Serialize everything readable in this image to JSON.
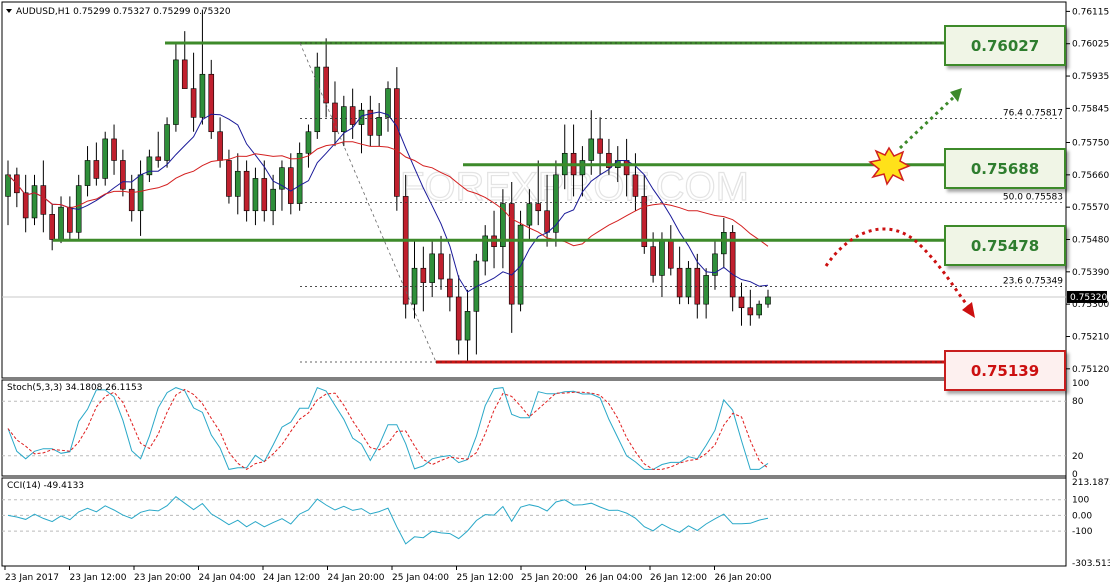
{
  "header": {
    "symbol": "AUDUSD,H1",
    "ohlc": "0.75299 0.75327 0.75299 0.75320",
    "title": "AUDUSD,H1  0.75299 0.75327 0.75299 0.75320"
  },
  "watermark": "FOREXPROF.COM",
  "price_axis": {
    "ticks": [
      "0.76115",
      "0.76025",
      "0.75935",
      "0.75845",
      "0.75750",
      "0.75660",
      "0.75570",
      "0.75480",
      "0.75390",
      "0.75300",
      "0.75210",
      "0.75120"
    ],
    "current_price": "0.75320"
  },
  "levels": [
    {
      "value": "0.76027",
      "color": "#3d8a2a",
      "style": "resistance"
    },
    {
      "value": "0.75688",
      "color": "#3d8a2a",
      "style": "resistance"
    },
    {
      "value": "0.75478",
      "color": "#3d8a2a",
      "style": "support"
    },
    {
      "value": "0.75139",
      "color": "#c81e1e",
      "style": "support"
    }
  ],
  "fibonacci": [
    {
      "label": "76.4  0.75817"
    },
    {
      "label": "50.0  0.75583"
    },
    {
      "label": "23.6  0.75349"
    }
  ],
  "stoch": {
    "title": "Stoch(5,3,3) 34.1808 26.1153",
    "ticks": [
      "100",
      "80",
      "20",
      "0"
    ]
  },
  "cci": {
    "title": "CCI(14) -49.4133",
    "ticks": [
      "213.1872",
      "100",
      "0.00",
      "-100",
      "-303.5132"
    ]
  },
  "time_axis": {
    "labels": [
      "23 Jan 2017",
      "23 Jan 12:00",
      "23 Jan 20:00",
      "24 Jan 04:00",
      "24 Jan 12:00",
      "24 Jan 20:00",
      "25 Jan 04:00",
      "25 Jan 12:00",
      "25 Jan 20:00",
      "26 Jan 04:00",
      "26 Jan 12:00",
      "26 Jan 20:00"
    ]
  },
  "colors": {
    "bull_candle": "#2f8f3a",
    "bear_candle": "#c0202e",
    "ma_fast": "#1a1a99",
    "ma_slow": "#d42020",
    "stoch_main": "#2aa8c8",
    "stoch_signal": "#e02020",
    "cci_line": "#2aa8c8",
    "arrow_green": "#3d8a2a",
    "arrow_red": "#cc1010"
  },
  "chart_data": {
    "type": "candlestick",
    "candles": [
      [
        0.756,
        0.757,
        0.7552,
        0.7566
      ],
      [
        0.7566,
        0.7568,
        0.7557,
        0.7561
      ],
      [
        0.7561,
        0.7566,
        0.755,
        0.7554
      ],
      [
        0.7554,
        0.7566,
        0.7552,
        0.7563
      ],
      [
        0.7563,
        0.757,
        0.755,
        0.7555
      ],
      [
        0.7555,
        0.7558,
        0.7545,
        0.7548
      ],
      [
        0.7548,
        0.756,
        0.7547,
        0.7557
      ],
      [
        0.7557,
        0.756,
        0.7548,
        0.755
      ],
      [
        0.755,
        0.7566,
        0.7548,
        0.7563
      ],
      [
        0.7563,
        0.7574,
        0.756,
        0.757
      ],
      [
        0.757,
        0.7575,
        0.7563,
        0.7565
      ],
      [
        0.7565,
        0.7578,
        0.7563,
        0.7576
      ],
      [
        0.7576,
        0.758,
        0.7566,
        0.757
      ],
      [
        0.757,
        0.7573,
        0.756,
        0.7562
      ],
      [
        0.7562,
        0.7566,
        0.7553,
        0.7556
      ],
      [
        0.7556,
        0.757,
        0.7549,
        0.7566
      ],
      [
        0.7566,
        0.7573,
        0.7564,
        0.7571
      ],
      [
        0.7571,
        0.7578,
        0.7568,
        0.757
      ],
      [
        0.757,
        0.7582,
        0.7568,
        0.758
      ],
      [
        0.758,
        0.7603,
        0.7578,
        0.7598
      ],
      [
        0.7598,
        0.7606,
        0.759,
        0.759
      ],
      [
        0.759,
        0.76,
        0.7578,
        0.7582
      ],
      [
        0.7582,
        0.7612,
        0.758,
        0.7594
      ],
      [
        0.7594,
        0.7598,
        0.7576,
        0.7578
      ],
      [
        0.7578,
        0.7582,
        0.7568,
        0.757
      ],
      [
        0.757,
        0.7573,
        0.7558,
        0.756
      ],
      [
        0.756,
        0.7572,
        0.7555,
        0.7567
      ],
      [
        0.7567,
        0.757,
        0.7553,
        0.7556
      ],
      [
        0.7556,
        0.7568,
        0.7552,
        0.7565
      ],
      [
        0.7565,
        0.757,
        0.7553,
        0.7556
      ],
      [
        0.7556,
        0.7566,
        0.7552,
        0.7562
      ],
      [
        0.7562,
        0.757,
        0.7556,
        0.7568
      ],
      [
        0.7568,
        0.7572,
        0.7555,
        0.7558
      ],
      [
        0.7558,
        0.7575,
        0.7556,
        0.7572
      ],
      [
        0.7572,
        0.758,
        0.7568,
        0.7578
      ],
      [
        0.7578,
        0.76,
        0.7576,
        0.7596
      ],
      [
        0.7596,
        0.7604,
        0.7582,
        0.7586
      ],
      [
        0.7586,
        0.7592,
        0.7574,
        0.7578
      ],
      [
        0.7578,
        0.7588,
        0.7574,
        0.7585
      ],
      [
        0.7585,
        0.759,
        0.7576,
        0.758
      ],
      [
        0.758,
        0.7586,
        0.7572,
        0.7584
      ],
      [
        0.7584,
        0.7588,
        0.7574,
        0.7577
      ],
      [
        0.7577,
        0.7586,
        0.7574,
        0.7582
      ],
      [
        0.7582,
        0.7592,
        0.7578,
        0.759
      ],
      [
        0.759,
        0.7596,
        0.7556,
        0.756
      ],
      [
        0.756,
        0.7566,
        0.7526,
        0.753
      ],
      [
        0.753,
        0.7548,
        0.7526,
        0.754
      ],
      [
        0.754,
        0.7546,
        0.7528,
        0.7536
      ],
      [
        0.7536,
        0.7548,
        0.7532,
        0.7544
      ],
      [
        0.7544,
        0.7549,
        0.7534,
        0.7537
      ],
      [
        0.7537,
        0.7544,
        0.7528,
        0.7532
      ],
      [
        0.7532,
        0.7538,
        0.7516,
        0.752
      ],
      [
        0.752,
        0.7534,
        0.7514,
        0.7528
      ],
      [
        0.7528,
        0.7544,
        0.7516,
        0.7542
      ],
      [
        0.7542,
        0.7552,
        0.7538,
        0.7549
      ],
      [
        0.7549,
        0.7556,
        0.754,
        0.7546
      ],
      [
        0.7546,
        0.7562,
        0.754,
        0.7558
      ],
      [
        0.7558,
        0.7564,
        0.7522,
        0.753
      ],
      [
        0.753,
        0.7556,
        0.7528,
        0.7552
      ],
      [
        0.7552,
        0.7562,
        0.7548,
        0.7558
      ],
      [
        0.7558,
        0.757,
        0.7552,
        0.7556
      ],
      [
        0.7556,
        0.7566,
        0.7546,
        0.755
      ],
      [
        0.755,
        0.757,
        0.7546,
        0.7566
      ],
      [
        0.7566,
        0.758,
        0.7562,
        0.7572
      ],
      [
        0.7572,
        0.758,
        0.756,
        0.7566
      ],
      [
        0.7566,
        0.7574,
        0.756,
        0.757
      ],
      [
        0.757,
        0.7584,
        0.7566,
        0.7576
      ],
      [
        0.7576,
        0.7582,
        0.7566,
        0.7572
      ],
      [
        0.7572,
        0.7576,
        0.7566,
        0.7568
      ],
      [
        0.7568,
        0.7574,
        0.7564,
        0.757
      ],
      [
        0.757,
        0.7576,
        0.756,
        0.7566
      ],
      [
        0.7566,
        0.7572,
        0.7556,
        0.756
      ],
      [
        0.756,
        0.7566,
        0.7544,
        0.7546
      ],
      [
        0.7546,
        0.755,
        0.7536,
        0.7538
      ],
      [
        0.7538,
        0.755,
        0.7532,
        0.7548
      ],
      [
        0.7548,
        0.7552,
        0.7538,
        0.754
      ],
      [
        0.754,
        0.7546,
        0.753,
        0.7532
      ],
      [
        0.7532,
        0.7542,
        0.753,
        0.754
      ],
      [
        0.754,
        0.7544,
        0.7526,
        0.753
      ],
      [
        0.753,
        0.754,
        0.7526,
        0.7538
      ],
      [
        0.7538,
        0.7548,
        0.7534,
        0.7544
      ],
      [
        0.7544,
        0.7554,
        0.754,
        0.755
      ],
      [
        0.755,
        0.7552,
        0.7528,
        0.7532
      ],
      [
        0.7532,
        0.7536,
        0.7524,
        0.7529
      ],
      [
        0.7529,
        0.7534,
        0.7524,
        0.7527
      ],
      [
        0.7527,
        0.7531,
        0.7526,
        0.753
      ],
      [
        0.753,
        0.7534,
        0.7529,
        0.7532
      ]
    ],
    "ylim": [
      0.751,
      0.7613
    ]
  }
}
